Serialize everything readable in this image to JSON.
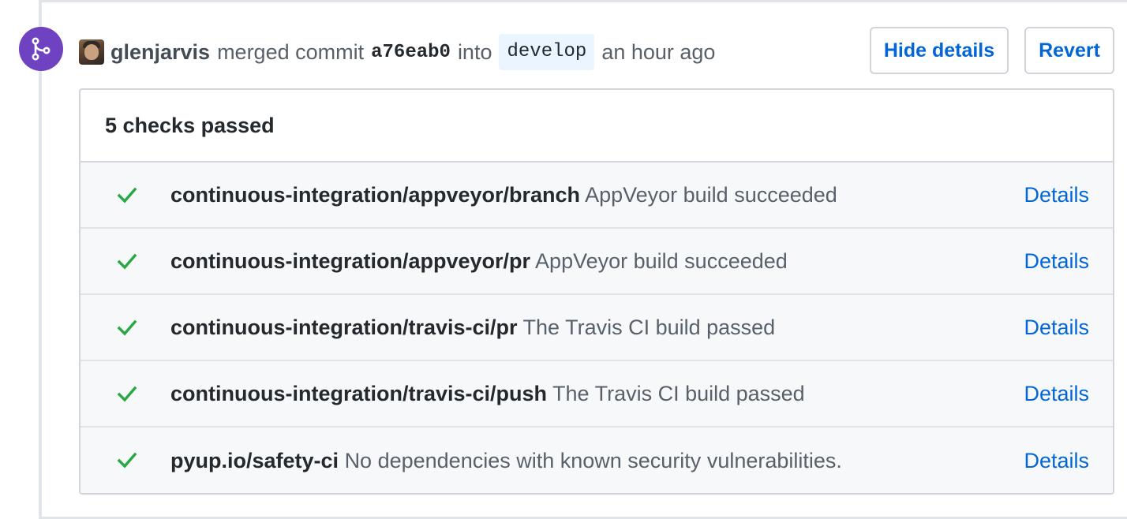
{
  "event": {
    "author": "glenjarvis",
    "action": "merged commit",
    "sha": "a76eab0",
    "into_label": "into",
    "branch": "develop",
    "time": "an hour ago"
  },
  "actions": {
    "hide_details": "Hide details",
    "revert": "Revert"
  },
  "checks": {
    "summary": "5 checks passed",
    "items": [
      {
        "context": "continuous-integration/appveyor/branch",
        "description": "AppVeyor build succeeded",
        "link": "Details",
        "status": "success"
      },
      {
        "context": "continuous-integration/appveyor/pr",
        "description": "AppVeyor build succeeded",
        "link": "Details",
        "status": "success"
      },
      {
        "context": "continuous-integration/travis-ci/pr",
        "description": "The Travis CI build passed",
        "link": "Details",
        "status": "success"
      },
      {
        "context": "continuous-integration/travis-ci/push",
        "description": "The Travis CI build passed",
        "link": "Details",
        "status": "success"
      },
      {
        "context": "pyup.io/safety-ci",
        "description": "No dependencies with known security vulnerabilities.",
        "link": "Details",
        "status": "success"
      }
    ]
  },
  "icons": {
    "badge": "git-merge-icon",
    "check": "check-icon"
  },
  "colors": {
    "merge_purple": "#6f42c1",
    "success_green": "#28a745",
    "link_blue": "#0366d6",
    "branch_bg": "#eaf5ff"
  }
}
